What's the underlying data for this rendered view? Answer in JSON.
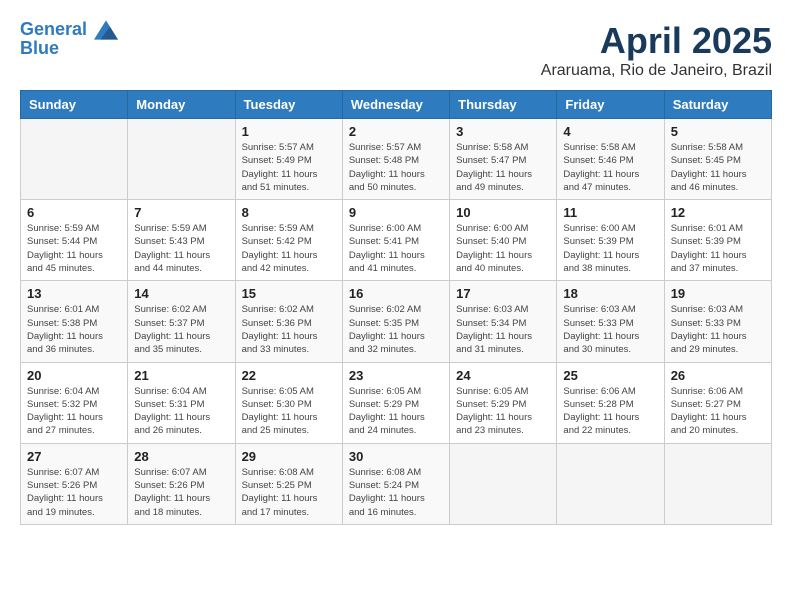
{
  "header": {
    "logo_line1": "General",
    "logo_line2": "Blue",
    "month_title": "April 2025",
    "location": "Araruama, Rio de Janeiro, Brazil"
  },
  "weekdays": [
    "Sunday",
    "Monday",
    "Tuesday",
    "Wednesday",
    "Thursday",
    "Friday",
    "Saturday"
  ],
  "weeks": [
    [
      {
        "day": "",
        "sunrise": "",
        "sunset": "",
        "daylight": ""
      },
      {
        "day": "",
        "sunrise": "",
        "sunset": "",
        "daylight": ""
      },
      {
        "day": "1",
        "sunrise": "Sunrise: 5:57 AM",
        "sunset": "Sunset: 5:49 PM",
        "daylight": "Daylight: 11 hours and 51 minutes."
      },
      {
        "day": "2",
        "sunrise": "Sunrise: 5:57 AM",
        "sunset": "Sunset: 5:48 PM",
        "daylight": "Daylight: 11 hours and 50 minutes."
      },
      {
        "day": "3",
        "sunrise": "Sunrise: 5:58 AM",
        "sunset": "Sunset: 5:47 PM",
        "daylight": "Daylight: 11 hours and 49 minutes."
      },
      {
        "day": "4",
        "sunrise": "Sunrise: 5:58 AM",
        "sunset": "Sunset: 5:46 PM",
        "daylight": "Daylight: 11 hours and 47 minutes."
      },
      {
        "day": "5",
        "sunrise": "Sunrise: 5:58 AM",
        "sunset": "Sunset: 5:45 PM",
        "daylight": "Daylight: 11 hours and 46 minutes."
      }
    ],
    [
      {
        "day": "6",
        "sunrise": "Sunrise: 5:59 AM",
        "sunset": "Sunset: 5:44 PM",
        "daylight": "Daylight: 11 hours and 45 minutes."
      },
      {
        "day": "7",
        "sunrise": "Sunrise: 5:59 AM",
        "sunset": "Sunset: 5:43 PM",
        "daylight": "Daylight: 11 hours and 44 minutes."
      },
      {
        "day": "8",
        "sunrise": "Sunrise: 5:59 AM",
        "sunset": "Sunset: 5:42 PM",
        "daylight": "Daylight: 11 hours and 42 minutes."
      },
      {
        "day": "9",
        "sunrise": "Sunrise: 6:00 AM",
        "sunset": "Sunset: 5:41 PM",
        "daylight": "Daylight: 11 hours and 41 minutes."
      },
      {
        "day": "10",
        "sunrise": "Sunrise: 6:00 AM",
        "sunset": "Sunset: 5:40 PM",
        "daylight": "Daylight: 11 hours and 40 minutes."
      },
      {
        "day": "11",
        "sunrise": "Sunrise: 6:00 AM",
        "sunset": "Sunset: 5:39 PM",
        "daylight": "Daylight: 11 hours and 38 minutes."
      },
      {
        "day": "12",
        "sunrise": "Sunrise: 6:01 AM",
        "sunset": "Sunset: 5:39 PM",
        "daylight": "Daylight: 11 hours and 37 minutes."
      }
    ],
    [
      {
        "day": "13",
        "sunrise": "Sunrise: 6:01 AM",
        "sunset": "Sunset: 5:38 PM",
        "daylight": "Daylight: 11 hours and 36 minutes."
      },
      {
        "day": "14",
        "sunrise": "Sunrise: 6:02 AM",
        "sunset": "Sunset: 5:37 PM",
        "daylight": "Daylight: 11 hours and 35 minutes."
      },
      {
        "day": "15",
        "sunrise": "Sunrise: 6:02 AM",
        "sunset": "Sunset: 5:36 PM",
        "daylight": "Daylight: 11 hours and 33 minutes."
      },
      {
        "day": "16",
        "sunrise": "Sunrise: 6:02 AM",
        "sunset": "Sunset: 5:35 PM",
        "daylight": "Daylight: 11 hours and 32 minutes."
      },
      {
        "day": "17",
        "sunrise": "Sunrise: 6:03 AM",
        "sunset": "Sunset: 5:34 PM",
        "daylight": "Daylight: 11 hours and 31 minutes."
      },
      {
        "day": "18",
        "sunrise": "Sunrise: 6:03 AM",
        "sunset": "Sunset: 5:33 PM",
        "daylight": "Daylight: 11 hours and 30 minutes."
      },
      {
        "day": "19",
        "sunrise": "Sunrise: 6:03 AM",
        "sunset": "Sunset: 5:33 PM",
        "daylight": "Daylight: 11 hours and 29 minutes."
      }
    ],
    [
      {
        "day": "20",
        "sunrise": "Sunrise: 6:04 AM",
        "sunset": "Sunset: 5:32 PM",
        "daylight": "Daylight: 11 hours and 27 minutes."
      },
      {
        "day": "21",
        "sunrise": "Sunrise: 6:04 AM",
        "sunset": "Sunset: 5:31 PM",
        "daylight": "Daylight: 11 hours and 26 minutes."
      },
      {
        "day": "22",
        "sunrise": "Sunrise: 6:05 AM",
        "sunset": "Sunset: 5:30 PM",
        "daylight": "Daylight: 11 hours and 25 minutes."
      },
      {
        "day": "23",
        "sunrise": "Sunrise: 6:05 AM",
        "sunset": "Sunset: 5:29 PM",
        "daylight": "Daylight: 11 hours and 24 minutes."
      },
      {
        "day": "24",
        "sunrise": "Sunrise: 6:05 AM",
        "sunset": "Sunset: 5:29 PM",
        "daylight": "Daylight: 11 hours and 23 minutes."
      },
      {
        "day": "25",
        "sunrise": "Sunrise: 6:06 AM",
        "sunset": "Sunset: 5:28 PM",
        "daylight": "Daylight: 11 hours and 22 minutes."
      },
      {
        "day": "26",
        "sunrise": "Sunrise: 6:06 AM",
        "sunset": "Sunset: 5:27 PM",
        "daylight": "Daylight: 11 hours and 20 minutes."
      }
    ],
    [
      {
        "day": "27",
        "sunrise": "Sunrise: 6:07 AM",
        "sunset": "Sunset: 5:26 PM",
        "daylight": "Daylight: 11 hours and 19 minutes."
      },
      {
        "day": "28",
        "sunrise": "Sunrise: 6:07 AM",
        "sunset": "Sunset: 5:26 PM",
        "daylight": "Daylight: 11 hours and 18 minutes."
      },
      {
        "day": "29",
        "sunrise": "Sunrise: 6:08 AM",
        "sunset": "Sunset: 5:25 PM",
        "daylight": "Daylight: 11 hours and 17 minutes."
      },
      {
        "day": "30",
        "sunrise": "Sunrise: 6:08 AM",
        "sunset": "Sunset: 5:24 PM",
        "daylight": "Daylight: 11 hours and 16 minutes."
      },
      {
        "day": "",
        "sunrise": "",
        "sunset": "",
        "daylight": ""
      },
      {
        "day": "",
        "sunrise": "",
        "sunset": "",
        "daylight": ""
      },
      {
        "day": "",
        "sunrise": "",
        "sunset": "",
        "daylight": ""
      }
    ]
  ]
}
